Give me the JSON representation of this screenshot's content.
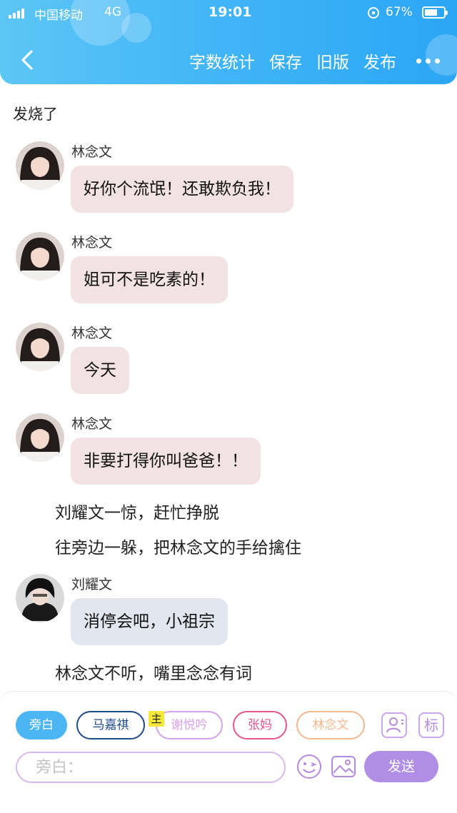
{
  "status_bar": {
    "carrier": "中国移动",
    "network": "4G",
    "time": "19:01",
    "battery": "67%",
    "battery_level": 0.67
  },
  "nav": {
    "back_icon": "chevron-left-icon",
    "actions": [
      "字数统计",
      "保存",
      "旧版",
      "发布"
    ],
    "more_icon": "more-dots-icon"
  },
  "chat": {
    "chapter_title": "发烧了",
    "messages": [
      {
        "speaker": "林念文",
        "text": "好你个流氓！还敢欺负我！",
        "style": "pink"
      },
      {
        "speaker": "林念文",
        "text": "姐可不是吃素的！",
        "style": "pink"
      },
      {
        "speaker": "林念文",
        "text": "今天",
        "style": "pink"
      },
      {
        "speaker": "林念文",
        "text": "非要打得你叫爸爸！！",
        "style": "pink"
      },
      {
        "speaker": "刘耀文",
        "text": "消停会吧，小祖宗",
        "style": "blue"
      }
    ],
    "narrations": [
      "刘耀文一惊，赶忙挣脱",
      "往旁边一躲，把林念文的手给擒住",
      "林念文不听，嘴里念念有词"
    ]
  },
  "composer": {
    "roles": [
      {
        "label": "旁白",
        "active": true,
        "color": "#4cb5f3"
      },
      {
        "label": "马嘉祺",
        "active": false,
        "color": "#1f4a8a"
      },
      {
        "label": "谢悦吟",
        "active": false,
        "color": "#d7a0ea"
      },
      {
        "label": "张妈",
        "active": false,
        "color": "#e2558f"
      },
      {
        "label": "林念文",
        "active": false,
        "color": "#f4b890"
      }
    ],
    "host_badge": "主",
    "role_manage_icon": "person-card-icon",
    "tag_button": "标",
    "input_placeholder": "旁白：",
    "emoji_icon": "smiley-icon",
    "image_icon": "image-icon",
    "send_label": "发送"
  },
  "colors": {
    "header_gradient_start": "#5cc6f5",
    "header_gradient_end": "#2ba6f5",
    "bubble_pink": "#f2e2e4",
    "bubble_blue": "#e2e6ee",
    "send_button": "#b08ee6"
  }
}
